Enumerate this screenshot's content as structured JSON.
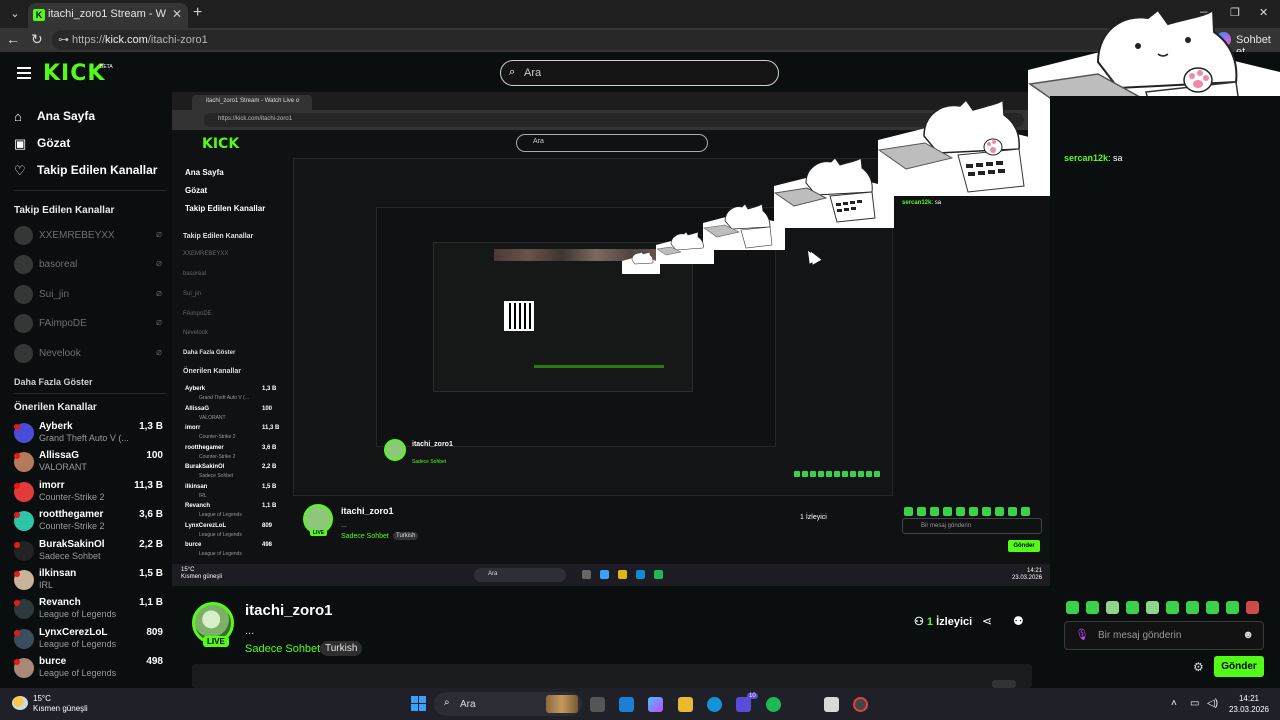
{
  "browser": {
    "tab_title": "itachi_zoro1 Stream - Watch Live o",
    "url_prefix": "https://",
    "url_domain": "kick.com",
    "url_path": "/itachi-zoro1",
    "copilot_label": "Sohbet et"
  },
  "header": {
    "logo": "KICK",
    "logo_badge": "BETA",
    "search_placeholder": "Ara"
  },
  "sidebar": {
    "nav": [
      {
        "label": "Ana Sayfa",
        "icon": "home-icon"
      },
      {
        "label": "Gözat",
        "icon": "browse-icon"
      },
      {
        "label": "Takip Edilen Kanallar",
        "icon": "heart-icon"
      }
    ],
    "following_heading": "Takip Edilen Kanallar",
    "following": [
      {
        "name": "XXEMREBEYXX"
      },
      {
        "name": "basoreal"
      },
      {
        "name": "Sui_jin"
      },
      {
        "name": "FAimpoDE"
      },
      {
        "name": "Nevelook"
      }
    ],
    "show_more": "Daha Fazla Göster",
    "recommended_heading": "Önerilen Kanallar",
    "recommended": [
      {
        "name": "Ayberk",
        "category": "Grand Theft Auto V (...",
        "viewers": "1,3 B",
        "color": "#4a4bd6"
      },
      {
        "name": "AllissaG",
        "category": "VALORANT",
        "viewers": "100",
        "color": "#b57a5a"
      },
      {
        "name": "imorr",
        "category": "Counter-Strike 2",
        "viewers": "11,3 B",
        "color": "#e23b3b"
      },
      {
        "name": "rootthegamer",
        "category": "Counter-Strike 2",
        "viewers": "3,6 B",
        "color": "#2ec4a6"
      },
      {
        "name": "BurakSakinOl",
        "category": "Sadece Sohbet",
        "viewers": "2,2 B",
        "color": "#222"
      },
      {
        "name": "ilkinsan",
        "category": "IRL",
        "viewers": "1,5 B",
        "color": "#c9b39a"
      },
      {
        "name": "Revanch",
        "category": "League of Legends",
        "viewers": "1,1 B",
        "color": "#2b3a3a"
      },
      {
        "name": "LynxCerezLoL",
        "category": "League of Legends",
        "viewers": "809",
        "color": "#3a4e5e"
      },
      {
        "name": "burce",
        "category": "League of Legends",
        "viewers": "498",
        "color": "#a88877"
      }
    ]
  },
  "player": {
    "tab_title": "itachi_zoro1 Stream - Watch Live o",
    "url": "https://kick.com/itachi-zoro1",
    "search_placeholder": "Ara",
    "nav": [
      "Ana Sayfa",
      "Gözat",
      "Takip Edilen Kanallar"
    ],
    "following_heading": "Takip Edilen Kanallar",
    "following": [
      "XXEMREBEYXX",
      "basoreal",
      "Sui_jin",
      "FAimpoDE",
      "Nevelook"
    ],
    "show_more": "Daha Fazla Göster",
    "recommended_heading": "Önerilen Kanallar",
    "recommended": [
      {
        "name": "Ayberk",
        "category": "Grand Theft Auto V (...",
        "viewers": "1,3 B"
      },
      {
        "name": "AllissaG",
        "category": "VALORANT",
        "viewers": "100"
      },
      {
        "name": "imorr",
        "category": "Counter-Strike 2",
        "viewers": "11,3 B"
      },
      {
        "name": "rootthegamer",
        "category": "Counter-Strike 2",
        "viewers": "3,6 B"
      },
      {
        "name": "BurakSakinOl",
        "category": "Sadece Sohbet",
        "viewers": "2,2 B"
      },
      {
        "name": "ilkinsan",
        "category": "IRL",
        "viewers": "1,5 B"
      },
      {
        "name": "Revanch",
        "category": "League of Legends",
        "viewers": "1,1 B"
      },
      {
        "name": "LynxCerezLoL",
        "category": "League of Legends",
        "viewers": "809"
      },
      {
        "name": "burce",
        "category": "League of Legends",
        "viewers": "498"
      }
    ],
    "inner_name": "itachi_zoro1",
    "inner_dots": "...",
    "inner_category": "Sadece Sohbet",
    "inner_tag": "Turkish",
    "inner_viewers": "1 İzleyici",
    "chat_user": "sercan12k",
    "chat_text": ": sa",
    "chat_placeholder": "Bir mesaj gönderin",
    "chat_send": "Gönder",
    "weather_temp": "15°C",
    "weather_desc": "Kısmen güneşli",
    "task_search": "Ara",
    "time": "14:21",
    "date": "23.03.2026"
  },
  "stream": {
    "name": "itachi_zoro1",
    "live_badge": "LIVE",
    "title_dots": "...",
    "category": "Sadece Sohbet",
    "tag": "Turkish",
    "viewer_count": "1",
    "viewer_label": "İzleyici"
  },
  "chat": {
    "messages": [
      {
        "user": "sercan12k",
        "text": ": sa"
      }
    ],
    "placeholder": "Bir mesaj gönderin",
    "send_label": "Gönder",
    "emotes": [
      "emote-1",
      "emote-2",
      "emote-3",
      "emote-4",
      "emote-5",
      "emote-6",
      "emote-7",
      "emote-8",
      "emote-9",
      "emote-10"
    ]
  },
  "taskbar": {
    "temperature": "15°C",
    "weather": "Kısmen güneşli",
    "search_placeholder": "Ara",
    "badge_count": "10",
    "time": "14:21",
    "date": "23.03.2026"
  },
  "colors": {
    "brand": "#53fc18",
    "background": "#0b0e0f",
    "offline_dot": "#e91916"
  }
}
